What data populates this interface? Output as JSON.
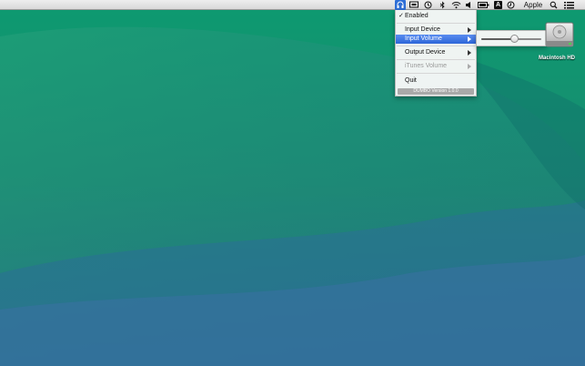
{
  "menubar": {
    "right_label": "Apple",
    "icons": [
      "dumbo-headphones-icon",
      "display-icon",
      "time-machine-icon",
      "bluetooth-icon",
      "wifi-icon",
      "volume-icon",
      "battery-icon",
      "input-source-icon",
      "clock-icon",
      "spotlight-search-icon",
      "notification-center-icon"
    ]
  },
  "menu": {
    "items": [
      {
        "label": "Enabled",
        "checked": true
      },
      {
        "label": "Input Device"
      },
      {
        "label": "Input Volume",
        "highlighted": true
      },
      {
        "label": "Output Device"
      },
      {
        "label": "iTunes Volume",
        "disabled": true
      },
      {
        "label": "Quit"
      }
    ],
    "version": "DUMBO Version 1.0.0",
    "checkmark": "✓"
  },
  "volume_slider": {
    "value": 0.55
  },
  "desktop": {
    "icons": [
      {
        "label": "Macintosh HD",
        "icon": "hard-drive-icon"
      }
    ]
  },
  "colors": {
    "highlight": "#2d66d8",
    "menubar": "#e4e4e4",
    "wallpaper_top": "#0f8e6a",
    "wallpaper_bottom": "#3f6f9f"
  }
}
